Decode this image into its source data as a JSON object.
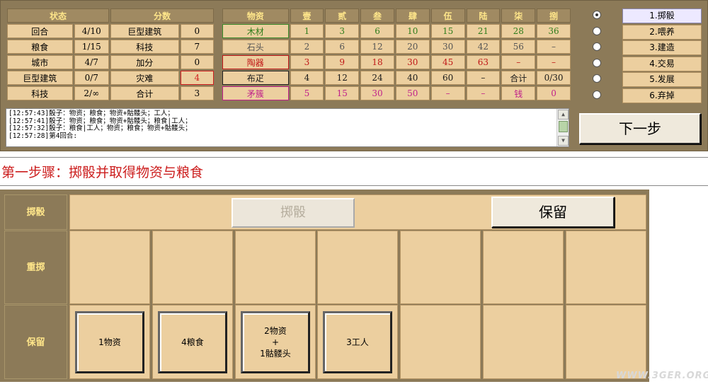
{
  "status": {
    "headers": [
      "状态",
      "分数"
    ],
    "rows": [
      {
        "label": "回合",
        "value": "4/10",
        "score_label": "巨型建筑",
        "score": "0",
        "alert": false
      },
      {
        "label": "粮食",
        "value": "1/15",
        "score_label": "科技",
        "score": "7",
        "alert": false
      },
      {
        "label": "城市",
        "value": "4/7",
        "score_label": "加分",
        "score": "0",
        "alert": false
      },
      {
        "label": "巨型建筑",
        "value": "0/7",
        "score_label": "灾难",
        "score": "4",
        "alert": true
      },
      {
        "label": "科技",
        "value": "2/∞",
        "score_label": "合计",
        "score": "3",
        "alert": false
      }
    ]
  },
  "materials": {
    "headers": [
      "物资",
      "壹",
      "贰",
      "叁",
      "肆",
      "伍",
      "陆",
      "柒",
      "捌"
    ],
    "rows": [
      {
        "name": "木材",
        "cells": [
          "1",
          "3",
          "6",
          "10",
          "15",
          "21",
          "28",
          "36"
        ],
        "style": "c-wood"
      },
      {
        "name": "石头",
        "cells": [
          "2",
          "6",
          "12",
          "20",
          "30",
          "42",
          "56",
          "–"
        ],
        "style": "c-stone"
      },
      {
        "name": "陶器",
        "cells": [
          "3",
          "9",
          "18",
          "30",
          "45",
          "63",
          "–",
          "–"
        ],
        "style": "c-pottery"
      },
      {
        "name": "布疋",
        "cells": [
          "4",
          "12",
          "24",
          "40",
          "60",
          "–",
          "合计",
          "0/30"
        ],
        "style": "c-cloth"
      },
      {
        "name": "矛簇",
        "cells": [
          "5",
          "15",
          "30",
          "50",
          "–",
          "–",
          "钱",
          "0"
        ],
        "style": "c-spear"
      }
    ]
  },
  "actions": {
    "items": [
      {
        "label": "1.掷骰",
        "selected": true
      },
      {
        "label": "2.喂养",
        "selected": false
      },
      {
        "label": "3.建造",
        "selected": false
      },
      {
        "label": "4.交易",
        "selected": false
      },
      {
        "label": "5.发展",
        "selected": false
      },
      {
        "label": "6.弃掉",
        "selected": false
      }
    ],
    "next_label": "下一步"
  },
  "log": {
    "lines": [
      "[12:57:43]骰子：物资；粮食；物资+骷髅头；工人；",
      "[12:57:41]骰子：物资；粮食；物资+骷髅头；粮食|工人；",
      "[12:57:32]骰子：粮食|工人；物资；粮食；物资+骷髅头；",
      "[12:57:28]第4回合:"
    ]
  },
  "step": {
    "title": "第一步骤：掷骰并取得物资与粮食"
  },
  "dice_board": {
    "row_labels": [
      "掷骰",
      "重掷",
      "保留"
    ],
    "roll_button": "掷骰",
    "keep_button": "保留",
    "kept_dice": [
      "1物资",
      "4粮食",
      "2物资\n+\n1骷髅头",
      "3工人"
    ]
  },
  "watermark": "WWW.3GER.ORG"
}
